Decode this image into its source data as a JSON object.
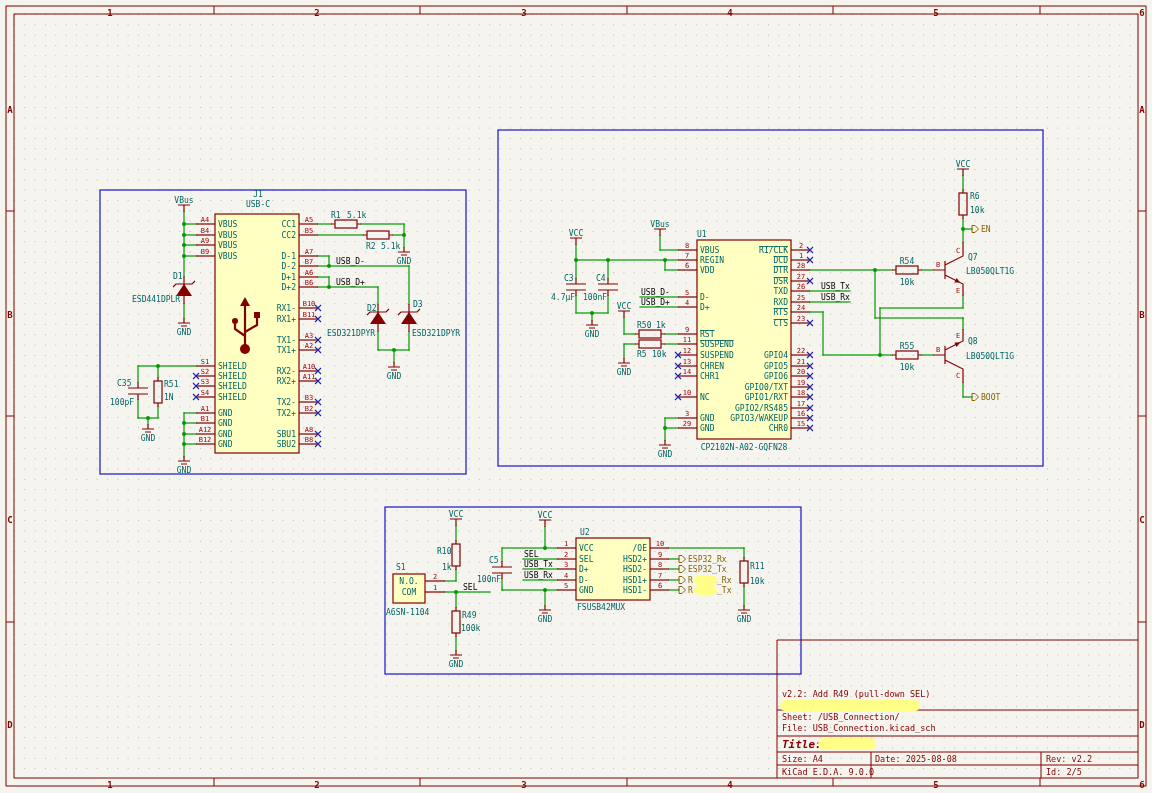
{
  "frame": {
    "top_markers": [
      "1",
      "2",
      "3",
      "4",
      "5",
      "6"
    ],
    "bottom_markers": [
      "1",
      "2",
      "3",
      "4",
      "5",
      "6"
    ],
    "left_markers": [
      "A",
      "B",
      "C",
      "D"
    ],
    "right_markers": [
      "A",
      "B",
      "C",
      "D"
    ]
  },
  "sections": [
    {
      "symbols": [
        {
          "kind": "connector",
          "ref": "J1",
          "value": "USB-C",
          "left_pins": [
            {
              "number": "A4",
              "name": "VBUS",
              "no_connect": false,
              "inverted": false
            },
            {
              "number": "B4",
              "name": "VBUS",
              "no_connect": false,
              "inverted": false
            },
            {
              "number": "A9",
              "name": "VBUS",
              "no_connect": false,
              "inverted": false
            },
            {
              "number": "B9",
              "name": "VBUS",
              "no_connect": false,
              "inverted": false
            },
            {
              "number": "S1",
              "name": "SHIELD",
              "no_connect": false,
              "inverted": false
            },
            {
              "number": "S2",
              "name": "SHIELD",
              "no_connect": true,
              "inverted": false
            },
            {
              "number": "S3",
              "name": "SHIELD",
              "no_connect": true,
              "inverted": false
            },
            {
              "number": "S4",
              "name": "SHIELD",
              "no_connect": true,
              "inverted": false
            },
            {
              "number": "A1",
              "name": "GND",
              "no_connect": false,
              "inverted": false
            },
            {
              "number": "B1",
              "name": "GND",
              "no_connect": false,
              "inverted": false
            },
            {
              "number": "A12",
              "name": "GND",
              "no_connect": false,
              "inverted": false
            },
            {
              "number": "B12",
              "name": "GND",
              "no_connect": false,
              "inverted": false
            }
          ],
          "right_pins": [
            {
              "number": "A5",
              "name": "CC1",
              "no_connect": false,
              "inverted": false
            },
            {
              "number": "B5",
              "name": "CC2",
              "no_connect": false,
              "inverted": false
            },
            {
              "number": "A7",
              "name": "D-1",
              "no_connect": false,
              "inverted": false
            },
            {
              "number": "B7",
              "name": "D-2",
              "no_connect": false,
              "inverted": false
            },
            {
              "number": "A6",
              "name": "D+1",
              "no_connect": false,
              "inverted": false
            },
            {
              "number": "B6",
              "name": "D+2",
              "no_connect": false,
              "inverted": false
            },
            {
              "number": "B10",
              "name": "RX1-",
              "no_connect": true,
              "inverted": false
            },
            {
              "number": "B11",
              "name": "RX1+",
              "no_connect": true,
              "inverted": false
            },
            {
              "number": "A3",
              "name": "TX1-",
              "no_connect": true,
              "inverted": false
            },
            {
              "number": "A2",
              "name": "TX1+",
              "no_connect": true,
              "inverted": false
            },
            {
              "number": "A10",
              "name": "RX2-",
              "no_connect": true,
              "inverted": false
            },
            {
              "number": "A11",
              "name": "RX2+",
              "no_connect": true,
              "inverted": false
            },
            {
              "number": "B3",
              "name": "TX2-",
              "no_connect": true,
              "inverted": false
            },
            {
              "number": "B2",
              "name": "TX2+",
              "no_connect": true,
              "inverted": false
            },
            {
              "number": "A8",
              "name": "SBU1",
              "no_connect": true,
              "inverted": false
            },
            {
              "number": "B8",
              "name": "SBU2",
              "no_connect": true,
              "inverted": false
            }
          ]
        },
        {
          "kind": "resistor",
          "ref": "R1",
          "value": "5.1k"
        },
        {
          "kind": "resistor",
          "ref": "R2",
          "value": "5.1k"
        },
        {
          "kind": "tvs_diode",
          "ref": "D1",
          "value": "ESD441DPLR"
        },
        {
          "kind": "tvs_diode",
          "ref": "D2",
          "value": "ESD321DPYR"
        },
        {
          "kind": "tvs_diode",
          "ref": "D3",
          "value": "ESD321DPYR"
        },
        {
          "kind": "capacitor",
          "ref": "C35",
          "value": "100pF"
        },
        {
          "kind": "resistor",
          "ref": "R51",
          "value": "1N"
        }
      ],
      "power": [
        {
          "kind": "supply",
          "label": "VBus"
        },
        {
          "kind": "ground",
          "label": "GND"
        },
        {
          "kind": "ground",
          "label": "GND"
        },
        {
          "kind": "ground",
          "label": "GND"
        },
        {
          "kind": "ground",
          "label": "GND"
        },
        {
          "kind": "ground",
          "label": "GND"
        }
      ],
      "net_labels": [
        {
          "text": "USB_D-"
        },
        {
          "text": "USB_D+"
        }
      ]
    },
    {
      "symbols": [
        {
          "kind": "ic",
          "ref": "U1",
          "value": "CP2102N-A02-GQFN28",
          "left_pins": [
            {
              "number": "8",
              "name": "VBUS",
              "no_connect": false,
              "inverted": false
            },
            {
              "number": "7",
              "name": "REGIN",
              "no_connect": false,
              "inverted": false
            },
            {
              "number": "6",
              "name": "VDD",
              "no_connect": false,
              "inverted": false
            },
            {
              "number": "5",
              "name": "D-",
              "no_connect": false,
              "inverted": false
            },
            {
              "number": "4",
              "name": "D+",
              "no_connect": false,
              "inverted": false
            },
            {
              "number": "9",
              "name": "RST",
              "no_connect": false,
              "inverted": true
            },
            {
              "number": "11",
              "name": "SUSPEND",
              "no_connect": false,
              "inverted": true
            },
            {
              "number": "12",
              "name": "SUSPEND",
              "no_connect": true,
              "inverted": false
            },
            {
              "number": "13",
              "name": "CHREN",
              "no_connect": true,
              "inverted": false
            },
            {
              "number": "14",
              "name": "CHR1",
              "no_connect": true,
              "inverted": false
            },
            {
              "number": "10",
              "name": "NC",
              "no_connect": true,
              "inverted": false
            },
            {
              "number": "3",
              "name": "GND",
              "no_connect": false,
              "inverted": false
            },
            {
              "number": "29",
              "name": "GND",
              "no_connect": false,
              "inverted": false
            }
          ],
          "right_pins": [
            {
              "number": "2",
              "name": "RI/CLK",
              "no_connect": true,
              "inverted": true
            },
            {
              "number": "1",
              "name": "DCD",
              "no_connect": true,
              "inverted": true
            },
            {
              "number": "28",
              "name": "DTR",
              "no_connect": false,
              "inverted": true
            },
            {
              "number": "27",
              "name": "DSR",
              "no_connect": true,
              "inverted": true
            },
            {
              "number": "26",
              "name": "TXD",
              "no_connect": false,
              "inverted": false
            },
            {
              "number": "25",
              "name": "RXD",
              "no_connect": false,
              "inverted": false
            },
            {
              "number": "24",
              "name": "RTS",
              "no_connect": false,
              "inverted": true
            },
            {
              "number": "23",
              "name": "CTS",
              "no_connect": true,
              "inverted": true
            },
            {
              "number": "22",
              "name": "GPIO4",
              "no_connect": true,
              "inverted": false
            },
            {
              "number": "21",
              "name": "GPIO5",
              "no_connect": true,
              "inverted": false
            },
            {
              "number": "20",
              "name": "GPIO6",
              "no_connect": true,
              "inverted": false
            },
            {
              "number": "19",
              "name": "GPIO0/TXT",
              "no_connect": true,
              "inverted": false
            },
            {
              "number": "18",
              "name": "GPIO1/RXT",
              "no_connect": true,
              "inverted": false
            },
            {
              "number": "17",
              "name": "GPIO2/RS485",
              "no_connect": true,
              "inverted": false
            },
            {
              "number": "16",
              "name": "GPIO3/WAKEUP",
              "no_connect": true,
              "inverted": false
            },
            {
              "number": "15",
              "name": "CHR0",
              "no_connect": true,
              "inverted": false
            }
          ]
        },
        {
          "kind": "capacitor",
          "ref": "C3",
          "value": "4.7µF"
        },
        {
          "kind": "capacitor",
          "ref": "C4",
          "value": "100nF"
        },
        {
          "kind": "resistor",
          "ref": "R50",
          "value": "1k"
        },
        {
          "kind": "resistor",
          "ref": "R5",
          "value": "10k"
        },
        {
          "kind": "resistor",
          "ref": "R6",
          "value": "10k"
        },
        {
          "kind": "resistor",
          "ref": "R54",
          "value": "10k"
        },
        {
          "kind": "npn",
          "ref": "Q7",
          "value": "LB050QLT1G",
          "pins": [
            {
              "name": "B"
            },
            {
              "name": "C"
            },
            {
              "name": "E"
            }
          ]
        },
        {
          "kind": "resistor",
          "ref": "R55",
          "value": "10k"
        },
        {
          "kind": "npn",
          "ref": "Q8",
          "value": "LB050QLT1G",
          "pins": [
            {
              "name": "B"
            },
            {
              "name": "C"
            },
            {
              "name": "E"
            }
          ]
        }
      ],
      "power": [
        {
          "kind": "supply",
          "label": "VBus"
        },
        {
          "kind": "supply",
          "label": "VCC"
        },
        {
          "kind": "ground",
          "label": "GND"
        },
        {
          "kind": "supply",
          "label": "VCC"
        },
        {
          "kind": "ground",
          "label": "GND"
        },
        {
          "kind": "ground",
          "label": "GND"
        },
        {
          "kind": "supply",
          "label": "VCC"
        }
      ],
      "net_labels": [
        {
          "text": "USB_D-"
        },
        {
          "text": "USB_D+"
        },
        {
          "text": "USB_Tx"
        },
        {
          "text": "USB_Rx"
        }
      ],
      "global_labels": [
        {
          "text": "EN",
          "redacted": false
        },
        {
          "text": "BOOT",
          "redacted": false
        }
      ]
    },
    {
      "symbols": [
        {
          "kind": "switch",
          "ref": "S1",
          "value": "A6SN-1104",
          "pins": [
            {
              "number": "2",
              "name": "N.O."
            },
            {
              "number": "1",
              "name": "COM"
            }
          ]
        },
        {
          "kind": "resistor",
          "ref": "R10",
          "value": "1k"
        },
        {
          "kind": "resistor",
          "ref": "R49",
          "value": "100k"
        },
        {
          "kind": "capacitor",
          "ref": "C5",
          "value": "100nF"
        },
        {
          "kind": "ic",
          "ref": "U2",
          "value": "FSUSB42MUX",
          "left_pins": [
            {
              "number": "1",
              "name": "VCC",
              "no_connect": false,
              "inverted": false
            },
            {
              "number": "2",
              "name": "SEL",
              "no_connect": false,
              "inverted": false
            },
            {
              "number": "3",
              "name": "D+",
              "no_connect": false,
              "inverted": false
            },
            {
              "number": "4",
              "name": "D-",
              "no_connect": false,
              "inverted": false
            },
            {
              "number": "5",
              "name": "GND",
              "no_connect": false,
              "inverted": false
            }
          ],
          "right_pins": [
            {
              "number": "10",
              "name": "/OE",
              "no_connect": false,
              "inverted": false
            },
            {
              "number": "9",
              "name": "HSD2+",
              "no_connect": false,
              "inverted": false
            },
            {
              "number": "8",
              "name": "HSD2-",
              "no_connect": false,
              "inverted": false
            },
            {
              "number": "7",
              "name": "HSD1+",
              "no_connect": false,
              "inverted": false
            },
            {
              "number": "6",
              "name": "HSD1-",
              "no_connect": false,
              "inverted": false
            }
          ]
        },
        {
          "kind": "resistor",
          "ref": "R11",
          "value": "10k"
        }
      ],
      "power": [
        {
          "kind": "supply",
          "label": "VCC"
        },
        {
          "kind": "ground",
          "label": "GND"
        },
        {
          "kind": "supply",
          "label": "VCC"
        },
        {
          "kind": "ground",
          "label": "GND"
        },
        {
          "kind": "ground",
          "label": "GND"
        }
      ],
      "net_labels": [
        {
          "text": "SEL"
        },
        {
          "text": "SEL"
        },
        {
          "text": "USB_Tx"
        },
        {
          "text": "USB_Rx"
        }
      ],
      "global_labels": [
        {
          "text": "ESP32_Rx",
          "redacted": false
        },
        {
          "text": "ESP32_Tx",
          "redacted": false
        },
        {
          "text": "R",
          "redacted": true,
          "suffix": "_Rx"
        },
        {
          "text": "R",
          "redacted": true,
          "suffix": "_Tx"
        }
      ]
    }
  ],
  "title_block": {
    "comment": "v2.2: Add R49 (pull-down SEL)",
    "comment_redacted": true,
    "sheet": "Sheet: /USB_Connection/",
    "file": "File: USB_Connection.kicad_sch",
    "title_label": "Title:",
    "title_redacted": true,
    "size": "Size: A4",
    "date": "Date: 2025-08-08",
    "rev": "Rev: v2.2",
    "generator": "KiCad E.D.A. 9.0.0",
    "id": "Id: 2/5"
  }
}
